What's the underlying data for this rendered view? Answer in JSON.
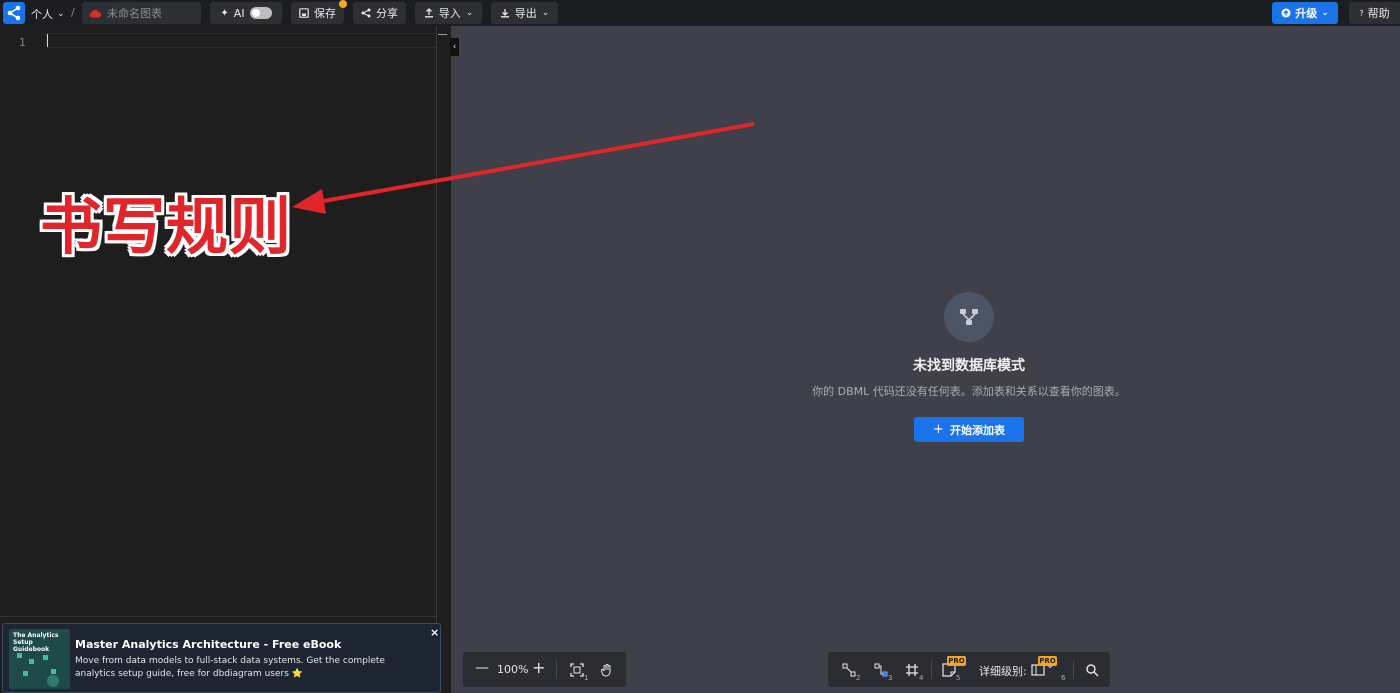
{
  "topbar": {
    "workspace": "个人",
    "separator": "/",
    "diagram_name": "未命名图表",
    "ai_label": "AI",
    "save_label": "保存",
    "share_label": "分享",
    "import_label": "导入",
    "export_label": "导出",
    "upgrade_label": "升级",
    "help_label": "帮助"
  },
  "editor": {
    "line_numbers": [
      "1"
    ]
  },
  "annotation": {
    "text": "书写规则",
    "color": "#e0262b"
  },
  "canvas": {
    "empty_title": "未找到数据库模式",
    "empty_description": "你的 DBML 代码还没有任何表。添加表和关系以查看你的图表。",
    "add_table_label": "开始添加表"
  },
  "zoom": {
    "level": "100%"
  },
  "tools": {
    "detail_label": "详细级别:",
    "pro_badge": "PRO",
    "shortcuts": [
      "2",
      "3",
      "4",
      "5",
      "6"
    ],
    "fit_shortcut": "1"
  },
  "ebook": {
    "thumb_title": "The Analytics Setup Guidebook",
    "title": "Master Analytics Architecture - Free eBook",
    "body": "Move from data models to full-stack data systems. Get the complete analytics setup guide, free for dbdiagram users ⭐",
    "close": "×"
  },
  "colors": {
    "accent": "#1a73e8",
    "pro": "#f5a623",
    "canvas_bg": "#3f404a"
  }
}
